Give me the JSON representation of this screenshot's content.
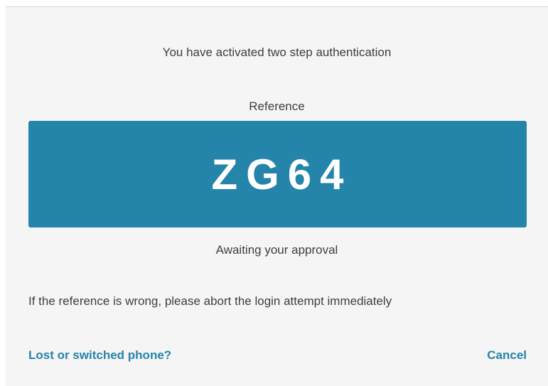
{
  "dialog": {
    "heading": "You have activated two step authentication",
    "reference_label": "Reference",
    "reference_code": "ZG64",
    "status": "Awaiting your approval",
    "warning": "If the reference is wrong, please abort the login attempt immediately",
    "lost_phone_link": "Lost or switched phone?",
    "cancel_link": "Cancel"
  },
  "colors": {
    "accent": "#2484aa",
    "panel_background": "#f5f5f5",
    "text": "#3f3f3f"
  }
}
